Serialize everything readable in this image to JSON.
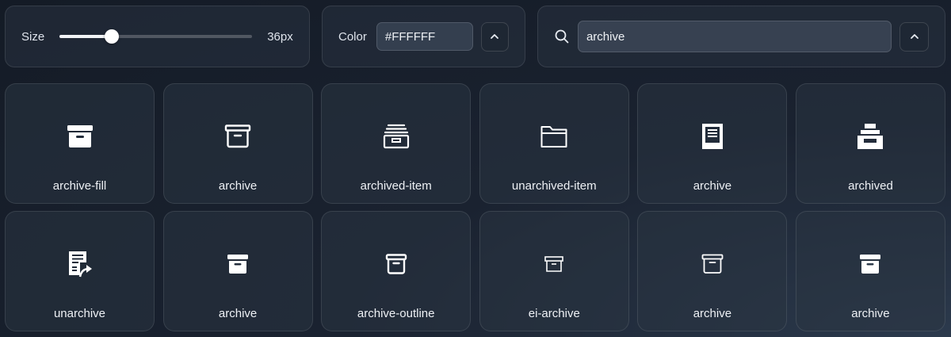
{
  "toolbar": {
    "size": {
      "label": "Size",
      "value_text": "36px",
      "slider_fraction": 0.27
    },
    "color": {
      "label": "Color",
      "value": "#FFFFFF"
    },
    "search": {
      "value": "archive"
    }
  },
  "icons": [
    {
      "name": "archive-fill",
      "icon": "archive-fill-icon"
    },
    {
      "name": "archive",
      "icon": "archive-outline-icon"
    },
    {
      "name": "archived-item",
      "icon": "archived-item-icon"
    },
    {
      "name": "unarchived-item",
      "icon": "folder-icon"
    },
    {
      "name": "archive",
      "icon": "archive-document-icon"
    },
    {
      "name": "archived",
      "icon": "archived-drawer-icon"
    },
    {
      "name": "unarchive",
      "icon": "unarchive-icon"
    },
    {
      "name": "archive",
      "icon": "archive-solid-small-icon"
    },
    {
      "name": "archive-outline",
      "icon": "archive-outline-small-icon"
    },
    {
      "name": "ei-archive",
      "icon": "ei-archive-icon"
    },
    {
      "name": "archive",
      "icon": "archive-thin-icon"
    },
    {
      "name": "archive",
      "icon": "archive-solid-small-icon"
    }
  ],
  "colors": {
    "icon": "#FFFFFF",
    "text": "#EEF1F5"
  }
}
